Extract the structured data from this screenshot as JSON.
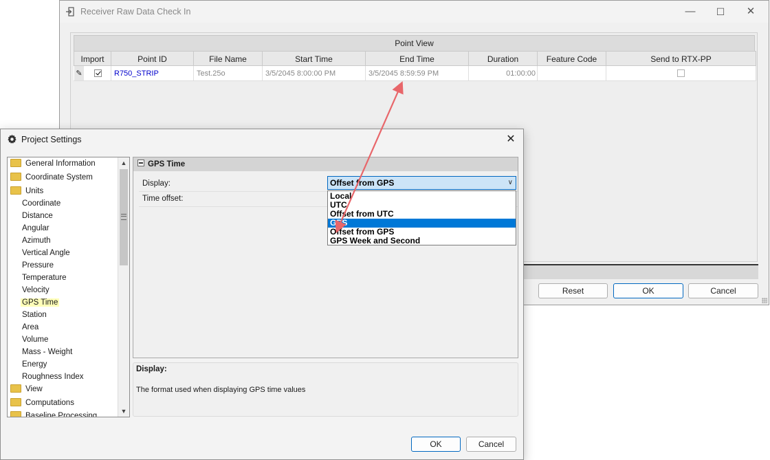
{
  "receiver_window": {
    "title": "Receiver Raw Data Check In",
    "point_view_header": "Point View",
    "columns": [
      "Import",
      "Point ID",
      "File Name",
      "Start Time",
      "End Time",
      "Duration",
      "Feature Code",
      "Send to RTX-PP"
    ],
    "row": {
      "import_checked": true,
      "point_id": "R750_STRIP",
      "file_name": "Test.25o",
      "start_time": "3/5/2045 8:00:00 PM",
      "end_time": "3/5/2045 8:59:59 PM",
      "duration": "01:00:00",
      "feature_code": "",
      "send_to_rtx_pp": false
    },
    "buttons": {
      "reset": "Reset",
      "ok": "OK",
      "cancel": "Cancel"
    }
  },
  "project_settings": {
    "title": "Project Settings",
    "tree": [
      {
        "label": "General Information",
        "type": "folder"
      },
      {
        "label": "Coordinate System",
        "type": "folder"
      },
      {
        "label": "Units",
        "type": "folder"
      },
      {
        "label": "Coordinate",
        "type": "item"
      },
      {
        "label": "Distance",
        "type": "item"
      },
      {
        "label": "Angular",
        "type": "item"
      },
      {
        "label": "Azimuth",
        "type": "item"
      },
      {
        "label": "Vertical Angle",
        "type": "item"
      },
      {
        "label": "Pressure",
        "type": "item"
      },
      {
        "label": "Temperature",
        "type": "item"
      },
      {
        "label": "Velocity",
        "type": "item"
      },
      {
        "label": "GPS Time",
        "type": "item",
        "selected": true
      },
      {
        "label": "Station",
        "type": "item"
      },
      {
        "label": "Area",
        "type": "item"
      },
      {
        "label": "Volume",
        "type": "item"
      },
      {
        "label": "Mass - Weight",
        "type": "item"
      },
      {
        "label": "Energy",
        "type": "item"
      },
      {
        "label": "Roughness Index",
        "type": "item"
      },
      {
        "label": "View",
        "type": "folder"
      },
      {
        "label": "Computations",
        "type": "folder"
      },
      {
        "label": "Baseline Processing",
        "type": "folder"
      }
    ],
    "category": "GPS Time",
    "properties": {
      "display_label": "Display:",
      "display_value": "Offset from GPS",
      "time_offset_label": "Time offset:"
    },
    "dropdown_options": [
      "Local",
      "UTC",
      "Offset from UTC",
      "GPS",
      "Offset from GPS",
      "GPS Week and Second"
    ],
    "dropdown_highlighted": "GPS",
    "help": {
      "title": "Display:",
      "text": "The format used when displaying GPS time values"
    },
    "buttons": {
      "ok": "OK",
      "cancel": "Cancel"
    }
  },
  "annotation_arrow_color": "#e8666a",
  "colors": {
    "accent": "#0067c0",
    "selection": "#0078d7",
    "point_id_link": "#0000cc"
  }
}
